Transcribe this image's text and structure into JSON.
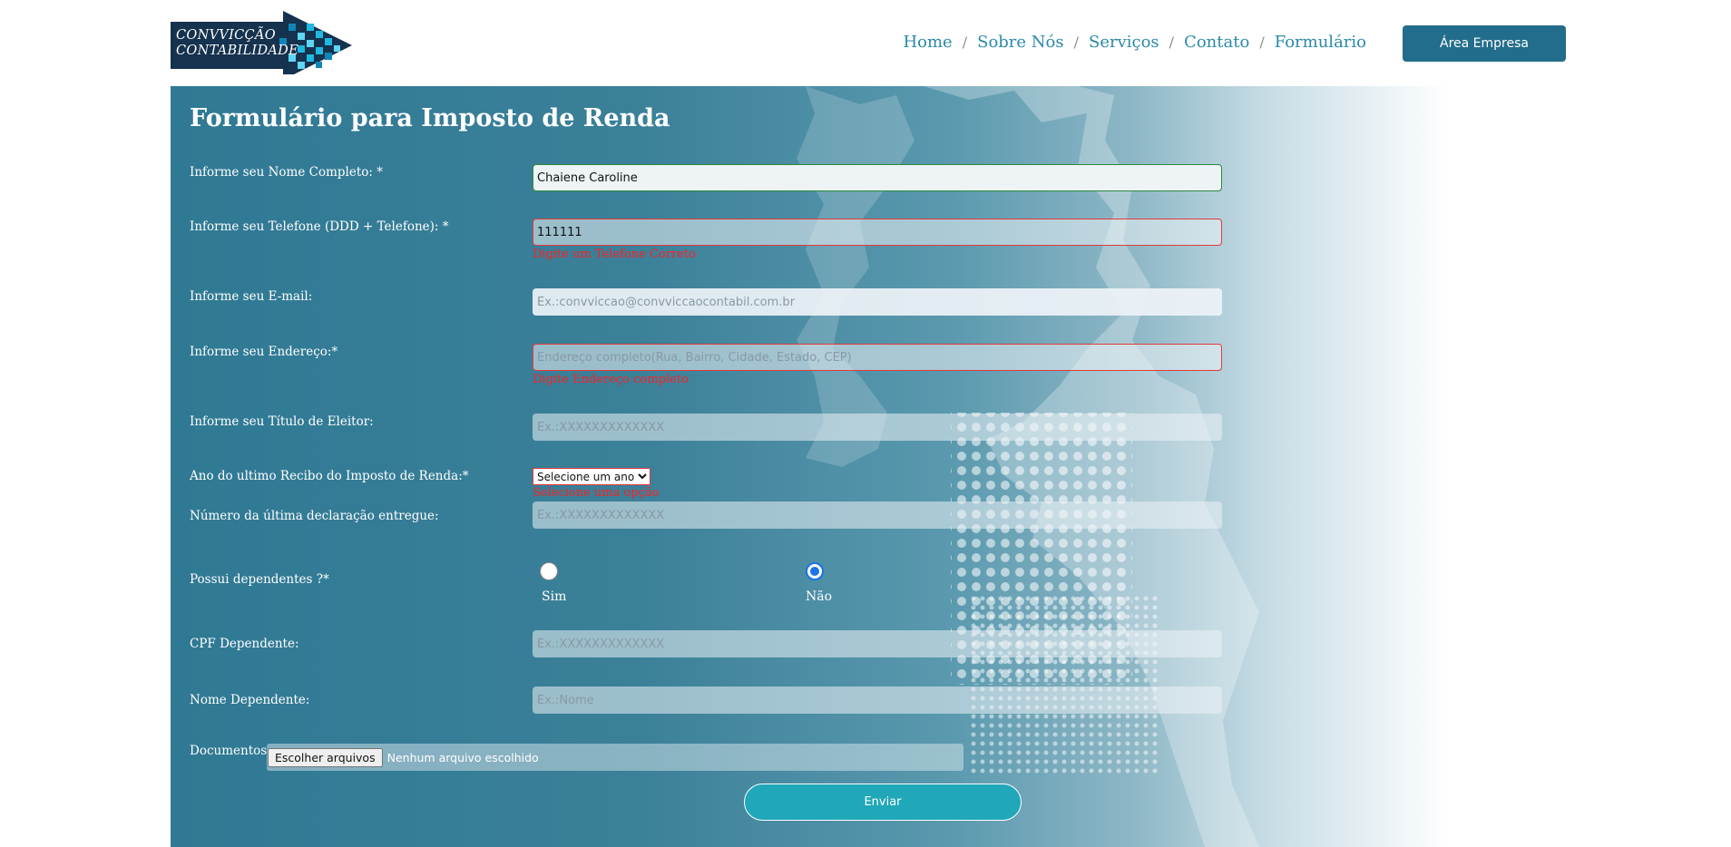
{
  "header": {
    "logo_text": "CONVVICÇÃO\nCONTABILIDADE",
    "nav": {
      "home": "Home",
      "sobre": "Sobre Nós",
      "servicos": "Serviços",
      "contato": "Contato",
      "formulario": "Formulário",
      "separator": "/"
    },
    "area_empresa": "Área Empresa"
  },
  "form": {
    "title": "Formulário para Imposto de Renda",
    "nome": {
      "label": "Informe seu Nome Completo: *",
      "value": "Chaiene Caroline"
    },
    "telefone": {
      "label": "Informe seu Telefone (DDD + Telefone): *",
      "value": "111111",
      "error": "Digite um Telefone Correto"
    },
    "email": {
      "label": "Informe seu E-mail:",
      "placeholder": "Ex.:convviccao@convviccaocontabil.com.br"
    },
    "endereco": {
      "label": "Informe seu Endereço:*",
      "placeholder": "Endereço completo(Rua, Bairro, Cidade, Estado, CEP)",
      "error": "Digite Endereço completo"
    },
    "titulo": {
      "label": "Informe seu Título de Eleitor:",
      "placeholder": "Ex.:XXXXXXXXXXXXX"
    },
    "ano": {
      "label": "Ano do ultimo Recibo do Imposto de Renda:*",
      "selected": "Selecione um ano",
      "error": "Selecione uma opção"
    },
    "numero": {
      "label": "Número da última declaração entregue:",
      "placeholder": "Ex.:XXXXXXXXXXXXX"
    },
    "dependentes": {
      "label": "Possui dependentes ?*",
      "sim": "Sim",
      "nao": "Não",
      "selected": "Não"
    },
    "cpf_dep": {
      "label": "CPF Dependente:",
      "placeholder": "Ex.:XXXXXXXXXXXXX"
    },
    "nome_dep": {
      "label": "Nome Dependente:",
      "placeholder": "Ex.:Nome"
    },
    "documentos": {
      "label": "Documentos:",
      "button": "Escolher arquivos",
      "status": "Nenhum arquivo escolhido"
    },
    "submit": "Enviar"
  },
  "colors": {
    "primary": "#226d8b",
    "link": "#2a8aa8",
    "error": "#ff2020",
    "submit": "#20a7b9"
  }
}
